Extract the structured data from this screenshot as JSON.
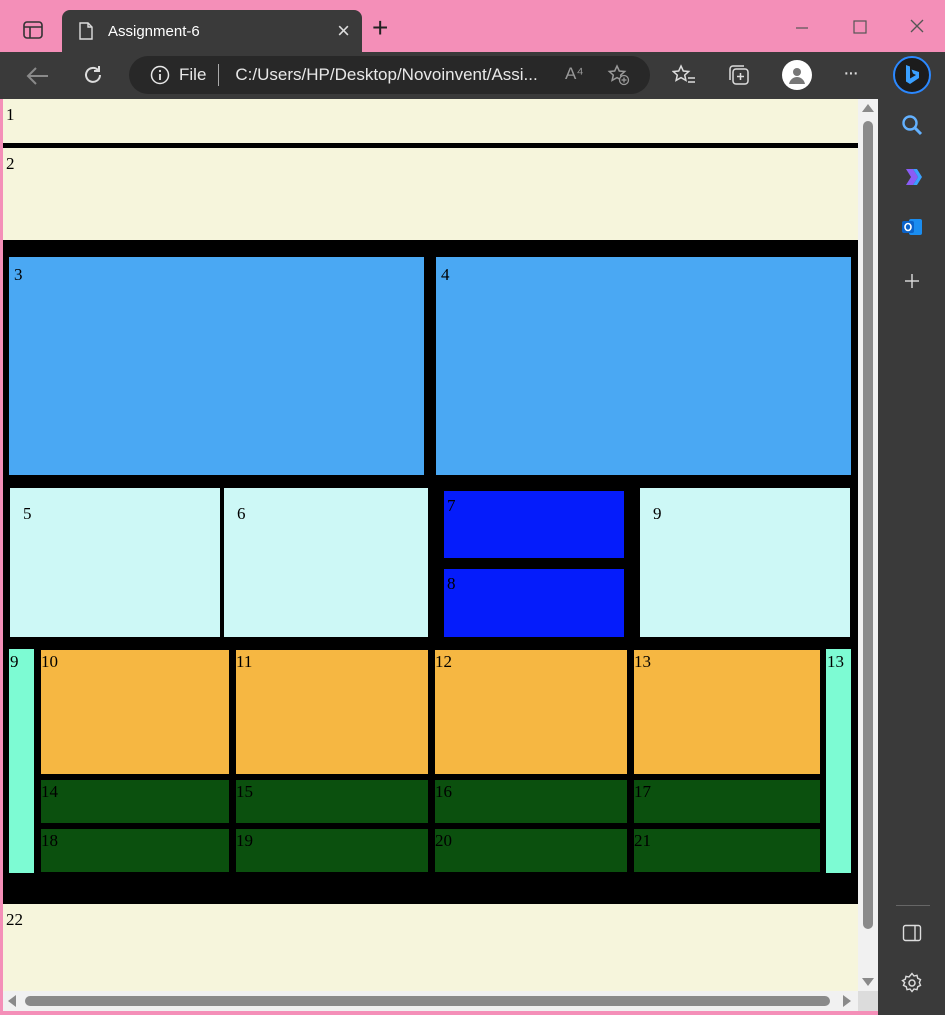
{
  "browser": {
    "tab_title": "Assignment-6",
    "new_tab_glyph": "+",
    "close_glyph": "×",
    "address_scheme": "File",
    "address_url": "C:/Users/HP/Desktop/Novoinvent/Assi...",
    "read_aloud_glyph": "A⁴",
    "more_glyph": "···"
  },
  "icons": [
    "tab-actions-icon",
    "page-icon",
    "back-icon",
    "refresh-icon",
    "info-icon",
    "read-aloud-icon",
    "add-favorite-icon",
    "favorites-icon",
    "collections-icon",
    "profile-icon",
    "more-icon",
    "bing-icon",
    "search-icon",
    "copilot-icon",
    "outlook-icon",
    "add-icon",
    "sidebar-toggle-icon",
    "settings-icon",
    "minimize-icon",
    "maximize-icon",
    "window-close-icon"
  ],
  "colors": {
    "header_bg": "#f6f5dc",
    "blue_box": "#4aa8f3",
    "light_cyan": "#cdf8f6",
    "deep_blue": "#051cfb",
    "mint": "#7dfbd3",
    "orange": "#f6b742",
    "dark_green": "#0b500e",
    "black": "#000000",
    "browser_bar": "#3a3a3a",
    "title_pink": "#f48fb8"
  },
  "page": {
    "rows": {
      "r1": "1",
      "r2": "2",
      "r22": "22"
    },
    "top_blocks": [
      "3",
      "4"
    ],
    "middle_blocks": {
      "b5": "5",
      "b6": "6",
      "b7": "7",
      "b8": "8",
      "b9": "9"
    },
    "grid_blocks": {
      "left_side": "9",
      "right_side": "13",
      "orange": [
        "10",
        "11",
        "12",
        "13"
      ],
      "green_row1": [
        "14",
        "15",
        "16",
        "17"
      ],
      "green_row2": [
        "18",
        "19",
        "20",
        "21"
      ]
    }
  }
}
